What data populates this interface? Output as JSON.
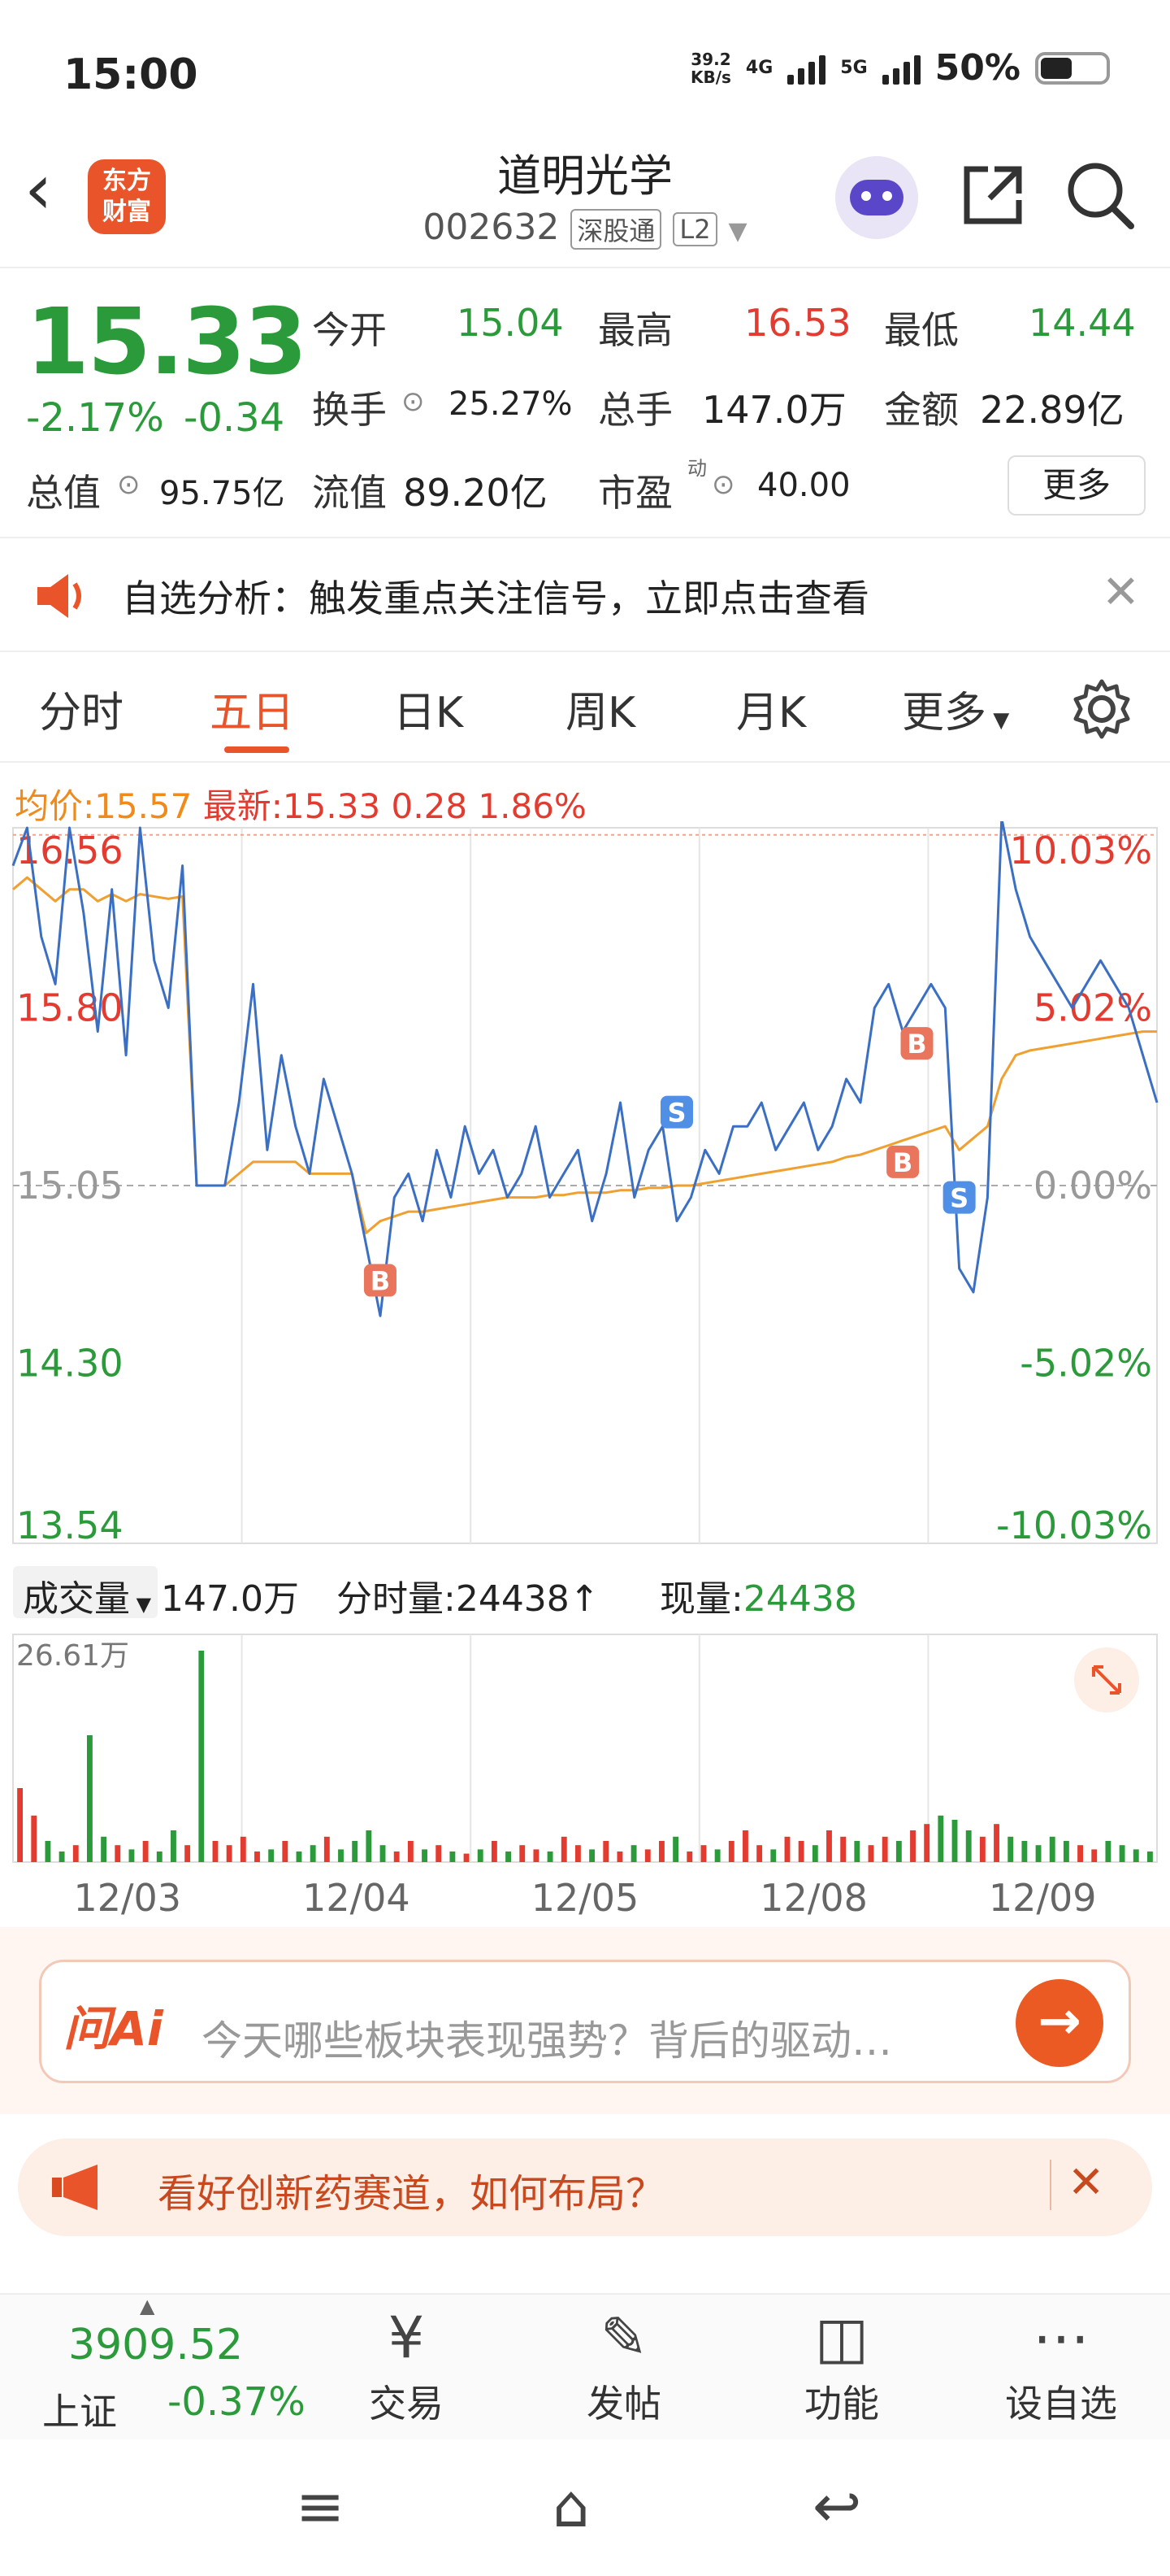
{
  "status_bar": {
    "time": "15:00",
    "net_speed": "39.2",
    "net_unit": "KB/s",
    "net1": "4G",
    "net2": "5G",
    "battery": "50%"
  },
  "header": {
    "logo_line1": "东方",
    "logo_line2": "财富",
    "title": "道明光学",
    "code": "002632",
    "tag1": "深股通",
    "tag2": "L2"
  },
  "quote": {
    "price": "15.33",
    "change_pct": "-2.17%",
    "change": "-0.34",
    "open_label": "今开",
    "open": "15.04",
    "high_label": "最高",
    "high": "16.53",
    "low_label": "最低",
    "low": "14.44",
    "turnover_label": "换手",
    "turnover": "25.27%",
    "volume_label": "总手",
    "volume": "147.0万",
    "amount_label": "金额",
    "amount": "22.89亿",
    "mktcap_label": "总值",
    "mktcap": "95.75亿",
    "float_label": "流值",
    "float": "89.20亿",
    "pe_label": "市盈",
    "pe_sup": "动",
    "pe": "40.00",
    "more": "更多"
  },
  "alert": {
    "text": "自选分析：触发重点关注信号，立即点击查看"
  },
  "tabs": [
    "分时",
    "五日",
    "日K",
    "周K",
    "月K",
    "更多"
  ],
  "legend": {
    "avg_label": "均价:",
    "avg": "15.57",
    "last_label": "最新:",
    "last": "15.33",
    "chg": "0.28",
    "pct": "1.86%"
  },
  "chart_data": {
    "type": "line",
    "y_ticks": [
      "16.56",
      "15.80",
      "15.05",
      "14.30",
      "13.54"
    ],
    "pct_ticks": [
      "10.03%",
      "5.02%",
      "0.00%",
      "-5.02%",
      "-10.03%"
    ],
    "x_labels": [
      "12/03",
      "12/04",
      "12/05",
      "12/08",
      "12/09"
    ],
    "ylim": [
      13.54,
      16.56
    ],
    "prev_close": 15.05,
    "price_series": [
      16.4,
      16.56,
      16.1,
      15.9,
      16.56,
      16.2,
      15.7,
      16.3,
      15.6,
      16.56,
      16.0,
      15.8,
      16.4,
      15.05,
      15.05,
      15.05,
      15.4,
      15.9,
      15.2,
      15.6,
      15.3,
      15.1,
      15.5,
      15.3,
      15.1,
      14.8,
      14.5,
      15.0,
      15.1,
      14.9,
      15.2,
      15.0,
      15.3,
      15.1,
      15.2,
      15.0,
      15.1,
      15.3,
      15.0,
      15.1,
      15.2,
      14.9,
      15.1,
      15.4,
      15.0,
      15.2,
      15.3,
      14.9,
      15.0,
      15.2,
      15.1,
      15.3,
      15.3,
      15.4,
      15.2,
      15.3,
      15.4,
      15.2,
      15.3,
      15.5,
      15.4,
      15.8,
      15.9,
      15.7,
      15.8,
      15.9,
      15.8,
      14.7,
      14.6,
      15.0,
      16.6,
      16.3,
      16.1,
      16.0,
      15.9,
      15.8,
      15.9,
      16.0,
      15.9,
      15.8,
      15.6,
      15.4
    ],
    "avg_series": [
      16.3,
      16.35,
      16.3,
      16.25,
      16.3,
      16.3,
      16.25,
      16.28,
      16.25,
      16.28,
      16.27,
      16.26,
      16.27,
      15.05,
      15.05,
      15.05,
      15.1,
      15.15,
      15.15,
      15.15,
      15.15,
      15.1,
      15.1,
      15.1,
      15.1,
      14.85,
      14.9,
      14.92,
      14.94,
      14.94,
      14.95,
      14.96,
      14.97,
      14.98,
      14.99,
      15.0,
      15.0,
      15.0,
      15.01,
      15.01,
      15.02,
      15.02,
      15.02,
      15.03,
      15.03,
      15.04,
      15.04,
      15.05,
      15.05,
      15.06,
      15.07,
      15.08,
      15.09,
      15.1,
      15.11,
      15.12,
      15.13,
      15.14,
      15.15,
      15.17,
      15.18,
      15.2,
      15.22,
      15.24,
      15.26,
      15.28,
      15.3,
      15.2,
      15.25,
      15.3,
      15.5,
      15.6,
      15.62,
      15.63,
      15.64,
      15.65,
      15.66,
      15.67,
      15.68,
      15.69,
      15.7,
      15.7
    ],
    "trade_marks": [
      {
        "type": "B",
        "price": 14.65
      },
      {
        "type": "S",
        "price": 15.36
      },
      {
        "type": "B",
        "price": 15.15
      },
      {
        "type": "S",
        "price": 15.0
      },
      {
        "type": "B",
        "price": 15.65
      }
    ],
    "volume_max": "26.61万",
    "volume_series": [
      0.35,
      0.22,
      0.1,
      0.05,
      0.08,
      0.6,
      0.12,
      0.08,
      0.06,
      0.1,
      0.05,
      0.15,
      0.08,
      1.0,
      0.1,
      0.08,
      0.12,
      0.05,
      0.06,
      0.1,
      0.05,
      0.08,
      0.12,
      0.06,
      0.1,
      0.15,
      0.08,
      0.05,
      0.1,
      0.06,
      0.08,
      0.05,
      0.04,
      0.06,
      0.1,
      0.05,
      0.08,
      0.06,
      0.05,
      0.12,
      0.08,
      0.06,
      0.1,
      0.05,
      0.08,
      0.06,
      0.1,
      0.12,
      0.05,
      0.08,
      0.06,
      0.1,
      0.15,
      0.08,
      0.06,
      0.12,
      0.1,
      0.08,
      0.15,
      0.12,
      0.1,
      0.08,
      0.12,
      0.1,
      0.15,
      0.18,
      0.22,
      0.2,
      0.15,
      0.12,
      0.18,
      0.12,
      0.1,
      0.08,
      0.12,
      0.1,
      0.08,
      0.06,
      0.1,
      0.08,
      0.06,
      0.05
    ]
  },
  "volume_header": {
    "selector": "成交量",
    "total": "147.0万",
    "tick_label": "分时量:",
    "tick_val": "24438",
    "now_label": "现量:",
    "now_val": "24438"
  },
  "ask_ai": {
    "logo": "问Ai",
    "question": "今天哪些板块表现强势？背后的驱动…"
  },
  "promo": {
    "text": "看好创新药赛道，如何布局？"
  },
  "bottom_nav": {
    "index_value": "3909.52",
    "index_name": "上证",
    "index_change": "-0.37%",
    "items": [
      "交易",
      "发帖",
      "功能",
      "设自选"
    ]
  }
}
